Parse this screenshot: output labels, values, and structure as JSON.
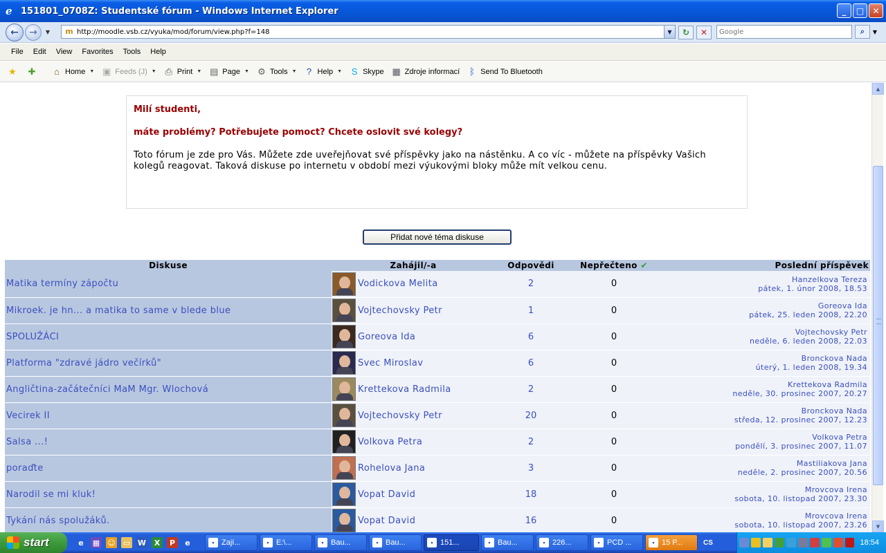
{
  "window": {
    "title": "151801_0708Z: Studentské fórum - Windows Internet Explorer",
    "controls": [
      "_",
      "□",
      "✕"
    ]
  },
  "address_bar": {
    "url": "http://moodle.vsb.cz/vyuka/mod/forum/view.php?f=148",
    "search_placeholder": "Google"
  },
  "menu": [
    "File",
    "Edit",
    "View",
    "Favorites",
    "Tools",
    "Help"
  ],
  "command_bar": {
    "home": "Home",
    "feeds": "Feeds (J)",
    "print": "Print",
    "page": "Page",
    "tools": "Tools",
    "help": "Help",
    "skype": "Skype",
    "zdroje": "Zdroje informací",
    "bluetooth": "Send To Bluetooth"
  },
  "intro": {
    "greeting": "Milí studenti,",
    "question": "máte problémy? Potřebujete pomoct? Chcete oslovit své kolegy?",
    "text": "Toto fórum je zde pro Vás. Můžete zde uveřejňovat své příspěvky jako na nástěnku. A co víc - můžete na příspěvky Vašich kolegů reagovat. Taková diskuse po internetu v období mezi výukovými bloky může mít velkou cenu."
  },
  "add_topic_button": "Přidat nové téma diskuse",
  "table": {
    "headers": {
      "discussion": "Diskuse",
      "started_by": "Zahájil/-a",
      "replies": "Odpovědi",
      "unread": "Nepřečteno",
      "last_post": "Poslední příspěvek"
    },
    "rows": [
      {
        "topic": "Matika termíny zápočtu",
        "starter": "Vodickova Melita",
        "replies": "2",
        "unread": "0",
        "last_author": "Hanzelkova Tereza",
        "last_date": "pátek, 1. únor 2008, 18.53",
        "avatar_color": "#8a5a2a"
      },
      {
        "topic": "Mikroek. je hn... a matika to same v blede blue",
        "starter": "Vojtechovsky Petr",
        "replies": "1",
        "unread": "0",
        "last_author": "Goreova Ida",
        "last_date": "pátek, 25. leden 2008, 22.20",
        "avatar_color": "#5a5040"
      },
      {
        "topic": "SPOLUŽÁCI",
        "starter": "Goreova Ida",
        "replies": "6",
        "unread": "0",
        "last_author": "Vojtechovsky Petr",
        "last_date": "neděle, 6. leden 2008, 22.03",
        "avatar_color": "#3a2a20"
      },
      {
        "topic": "Platforma \"zdravé jádro večírků\"",
        "starter": "Svec Miroslav",
        "replies": "6",
        "unread": "0",
        "last_author": "Bronckova Nada",
        "last_date": "úterý, 1. leden 2008, 19.34",
        "avatar_color": "#2a2a50"
      },
      {
        "topic": "Angličtina-začátečníci MaM Mgr. Wlochová",
        "starter": "Krettekova Radmila",
        "replies": "2",
        "unread": "0",
        "last_author": "Krettekova Radmila",
        "last_date": "neděle, 30. prosinec 2007, 20.27",
        "avatar_color": "#9a8a60"
      },
      {
        "topic": "Vecirek II",
        "starter": "Vojtechovsky Petr",
        "replies": "20",
        "unread": "0",
        "last_author": "Bronckova Nada",
        "last_date": "středa, 12. prosinec 2007, 12.23",
        "avatar_color": "#5a5040"
      },
      {
        "topic": "Salsa ...!",
        "starter": "Volkova Petra",
        "replies": "2",
        "unread": "0",
        "last_author": "Volkova Petra",
        "last_date": "pondělí, 3. prosinec 2007, 11.07",
        "avatar_color": "#202020"
      },
      {
        "topic": "poraďte",
        "starter": "Rohelova Jana",
        "replies": "3",
        "unread": "0",
        "last_author": "Mastiliakova Jana",
        "last_date": "neděle, 2. prosinec 2007, 20.56",
        "avatar_color": "#c07050"
      },
      {
        "topic": "Narodil se mi kluk!",
        "starter": "Vopat David",
        "replies": "18",
        "unread": "0",
        "last_author": "Mrovcova Irena",
        "last_date": "sobota, 10. listopad 2007, 23.30",
        "avatar_color": "#2a5aa0"
      },
      {
        "topic": "Tykání nás spolužáků.",
        "starter": "Vopat David",
        "replies": "16",
        "unread": "0",
        "last_author": "Mrovcova Irena",
        "last_date": "sobota, 10. listopad 2007, 23.26",
        "avatar_color": "#2a5aa0"
      }
    ]
  },
  "taskbar": {
    "start": "start",
    "tasks": [
      {
        "label": "Zají...",
        "state": "normal"
      },
      {
        "label": "E:\\...",
        "state": "normal"
      },
      {
        "label": "Bau...",
        "state": "normal"
      },
      {
        "label": "Bau...",
        "state": "normal"
      },
      {
        "label": "151...",
        "state": "active"
      },
      {
        "label": "Bau...",
        "state": "normal"
      },
      {
        "label": "226...",
        "state": "normal"
      },
      {
        "label": "PCD ...",
        "state": "normal"
      },
      {
        "label": "15 P...",
        "state": "alert"
      }
    ],
    "language": "CS",
    "clock": "18:54"
  }
}
